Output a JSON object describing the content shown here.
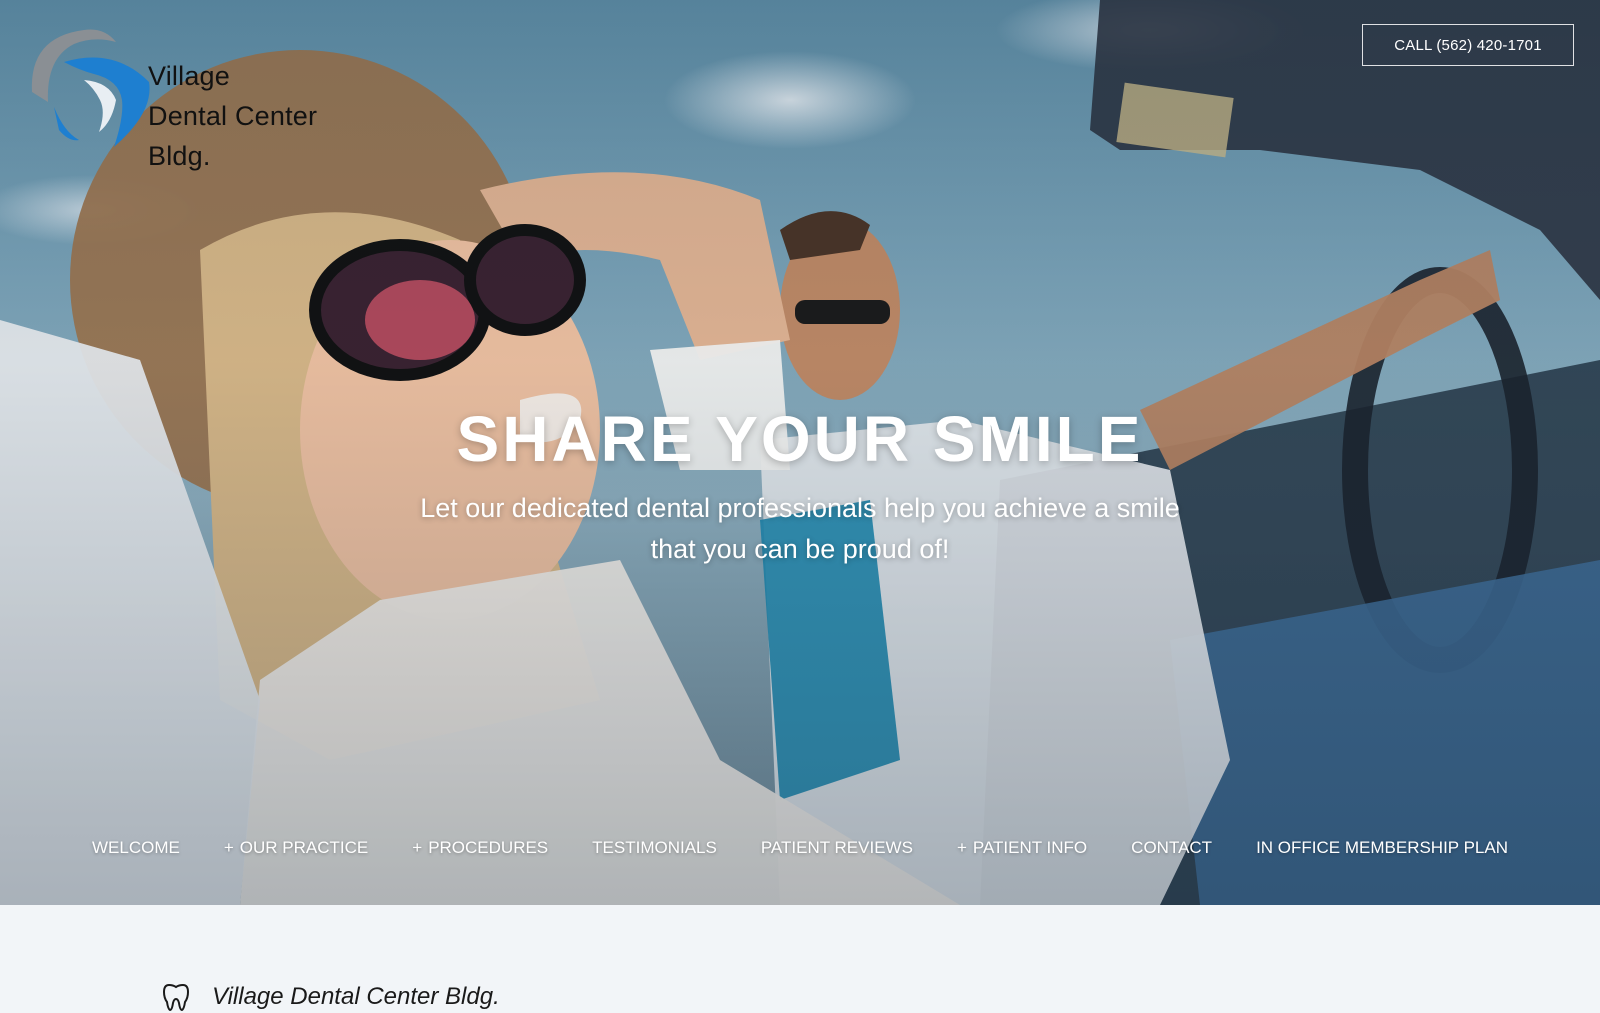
{
  "header": {
    "logo": {
      "line1": "Village",
      "line2": "Dental Center",
      "line3": "Bldg."
    },
    "call_button": "CALL (562) 420-1701"
  },
  "hero": {
    "headline": "SHARE YOUR SMILE",
    "subheadline": "Let our dedicated dental professionals help you achieve a smile that you can be proud of!"
  },
  "nav": {
    "items": [
      {
        "label": "WELCOME",
        "has_submenu": false,
        "prefix": ""
      },
      {
        "label": "OUR PRACTICE",
        "has_submenu": true,
        "prefix": "+"
      },
      {
        "label": "PROCEDURES",
        "has_submenu": true,
        "prefix": "+"
      },
      {
        "label": "TESTIMONIALS",
        "has_submenu": false,
        "prefix": ""
      },
      {
        "label": "PATIENT REVIEWS",
        "has_submenu": false,
        "prefix": ""
      },
      {
        "label": "PATIENT INFO",
        "has_submenu": true,
        "prefix": "+"
      },
      {
        "label": "CONTACT",
        "has_submenu": false,
        "prefix": ""
      },
      {
        "label": "IN OFFICE MEMBERSHIP PLAN",
        "has_submenu": false,
        "prefix": ""
      }
    ]
  },
  "section": {
    "title": "Village Dental Center Bldg.",
    "icon": "tooth-icon"
  },
  "colors": {
    "logo_blue": "#1e7fd0",
    "logo_gray": "#8a8f94",
    "section_bg": "#f2f5f8",
    "text_white": "#ffffff"
  }
}
